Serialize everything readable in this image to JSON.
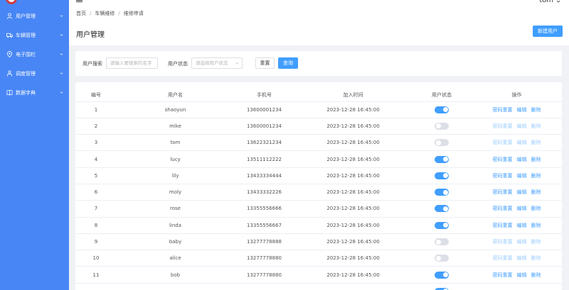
{
  "sidebar": {
    "items": [
      {
        "label": "用户管理",
        "icon": "user-icon"
      },
      {
        "label": "车辆管理",
        "icon": "truck-icon"
      },
      {
        "label": "电子围栏",
        "icon": "map-pin-icon"
      },
      {
        "label": "调度管理",
        "icon": "person-icon"
      },
      {
        "label": "数据字典",
        "icon": "book-icon"
      }
    ]
  },
  "header": {
    "breadcrumb": [
      "首页",
      "车辆维修",
      "维修申请"
    ],
    "username": "tom"
  },
  "page": {
    "title": "用户管理",
    "new_user_label": "新建用户"
  },
  "search": {
    "user_label": "用户搜索",
    "user_placeholder": "请输入要搜索的名字",
    "status_label": "用户状态",
    "status_placeholder": "请选择用户状态",
    "reset_label": "重置",
    "query_label": "查询"
  },
  "table": {
    "headers": [
      "编号",
      "用户名",
      "手机号",
      "加入时间",
      "用户状态",
      "操作"
    ],
    "actions": {
      "reset_pwd": "密码重置",
      "edit": "编辑",
      "delete": "删除"
    },
    "rows": [
      {
        "id": "1",
        "username": "shaoyun",
        "phone": "13600001234",
        "joined": "2023-12-28 16:45:00",
        "active": true
      },
      {
        "id": "2",
        "username": "mike",
        "phone": "13600001234",
        "joined": "2023-12-28 16:45:00",
        "active": false
      },
      {
        "id": "3",
        "username": "tom",
        "phone": "13622321234",
        "joined": "2023-12-28 16:45:00",
        "active": false
      },
      {
        "id": "4",
        "username": "lucy",
        "phone": "13511112222",
        "joined": "2023-12-28 16:45:00",
        "active": true
      },
      {
        "id": "5",
        "username": "lily",
        "phone": "13433334444",
        "joined": "2023-12-28 16:45:00",
        "active": true
      },
      {
        "id": "6",
        "username": "moly",
        "phone": "13433332226",
        "joined": "2023-12-28 16:45:00",
        "active": true
      },
      {
        "id": "7",
        "username": "rose",
        "phone": "13355556666",
        "joined": "2023-12-28 16:45:00",
        "active": true
      },
      {
        "id": "8",
        "username": "linda",
        "phone": "13355556667",
        "joined": "2023-12-28 16:45:00",
        "active": true
      },
      {
        "id": "9",
        "username": "baby",
        "phone": "13277778888",
        "joined": "2023-12-28 16:45:00",
        "active": false
      },
      {
        "id": "10",
        "username": "alice",
        "phone": "13277778880",
        "joined": "2023-12-28 16:45:00",
        "active": false
      },
      {
        "id": "11",
        "username": "bob",
        "phone": "13277778880",
        "joined": "2023-12-28 16:45:00",
        "active": true
      },
      {
        "id": "",
        "username": "",
        "phone": "",
        "joined": "",
        "active": true
      }
    ]
  },
  "colors": {
    "sidebar": "#4886f5",
    "primary": "#409eff",
    "primary_light": "#a0cfff",
    "toggle_off": "#dcdfe6",
    "background": "#f0f2f5"
  }
}
